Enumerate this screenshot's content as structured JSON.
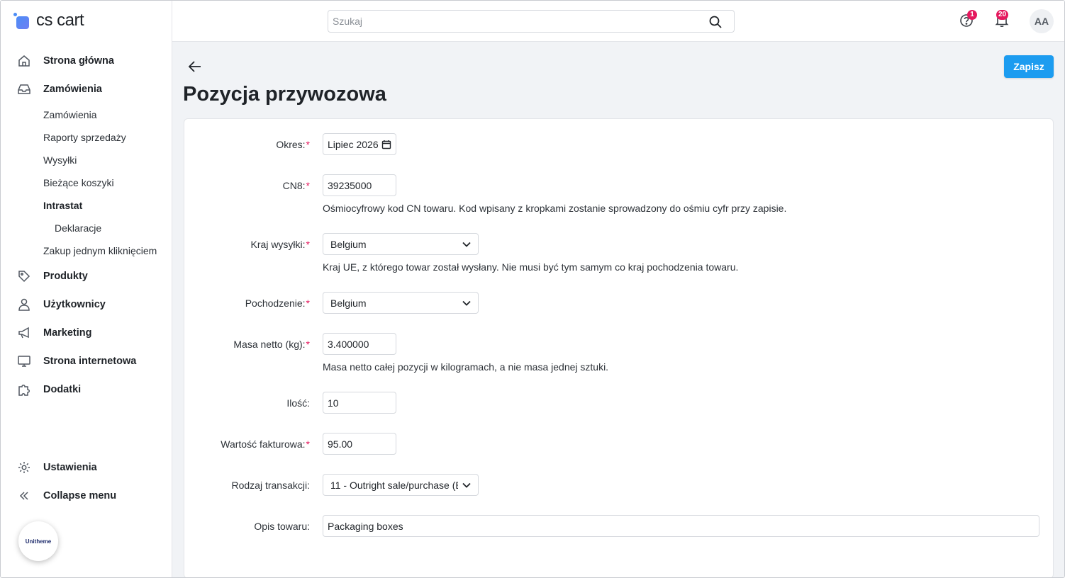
{
  "brand": {
    "logo_text": "cs cart",
    "partner_badge": "Unitheme"
  },
  "colors": {
    "accent": "#1c9cf0",
    "badge": "#e5195e",
    "required": "#e5195e",
    "background": "#f1f3f6"
  },
  "sidebar": {
    "items": [
      {
        "label": "Strona główna",
        "icon": "home-icon"
      },
      {
        "label": "Zamówienia",
        "icon": "inbox-icon"
      },
      {
        "label": "Produkty",
        "icon": "tag-icon"
      },
      {
        "label": "Użytkownicy",
        "icon": "user-icon"
      },
      {
        "label": "Marketing",
        "icon": "megaphone-icon"
      },
      {
        "label": "Strona internetowa",
        "icon": "monitor-icon"
      },
      {
        "label": "Dodatki",
        "icon": "puzzle-icon"
      }
    ],
    "orders_sub": [
      "Zamówienia",
      "Raporty sprzedaży",
      "Wysyłki",
      "Bieżące koszyki",
      "Intrastat",
      "Deklaracje",
      "Zakup jednym kliknięciem"
    ],
    "settings_label": "Ustawienia",
    "collapse_label": "Collapse menu"
  },
  "topbar": {
    "search_placeholder": "Szukaj",
    "help_badge": "1",
    "notifications_badge": "20",
    "avatar_initials": "AA"
  },
  "page": {
    "title": "Pozycja przywozowa",
    "save_label": "Zapisz"
  },
  "form": {
    "period": {
      "label": "Okres:",
      "value": "Lipiec  2026",
      "required": true
    },
    "cn8": {
      "label": "CN8:",
      "value": "39235000",
      "help": "Ośmiocyfrowy kod CN towaru. Kod wpisany z kropkami zostanie sprowadzony do ośmiu cyfr przy zapisie.",
      "required": true
    },
    "dispatch_country": {
      "label": "Kraj wysyłki:",
      "value": "Belgium",
      "help": "Kraj UE, z którego towar został wysłany. Nie musi być tym samym co kraj pochodzenia towaru.",
      "required": true
    },
    "origin": {
      "label": "Pochodzenie:",
      "value": "Belgium",
      "required": true
    },
    "net_mass": {
      "label": "Masa netto (kg):",
      "value": "3.400000",
      "help": "Masa netto całej pozycji w kilogramach, a nie masa jednej sztuki.",
      "required": true
    },
    "quantity": {
      "label": "Ilość:",
      "value": "10",
      "required": false
    },
    "invoice_value": {
      "label": "Wartość fakturowa:",
      "value": "95.00",
      "required": true
    },
    "transaction_type": {
      "label": "Rodzaj transakcji:",
      "value": "11 - Outright sale/purchase (B",
      "required": false
    },
    "description": {
      "label": "Opis towaru:",
      "value": "Packaging boxes",
      "required": false
    }
  }
}
